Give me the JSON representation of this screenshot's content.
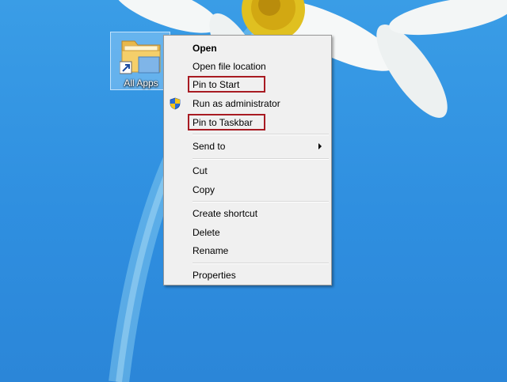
{
  "desktop": {
    "icon_label": "All Apps"
  },
  "context_menu": {
    "open": "Open",
    "open_file_location": "Open file location",
    "pin_to_start": "Pin to Start",
    "run_as_admin": "Run as administrator",
    "pin_to_taskbar": "Pin to Taskbar",
    "send_to": "Send to",
    "cut": "Cut",
    "copy": "Copy",
    "create_shortcut": "Create shortcut",
    "delete": "Delete",
    "rename": "Rename",
    "properties": "Properties"
  },
  "colors": {
    "highlight_box": "#a81b22",
    "wallpaper_blue": "#2f8fe0"
  }
}
